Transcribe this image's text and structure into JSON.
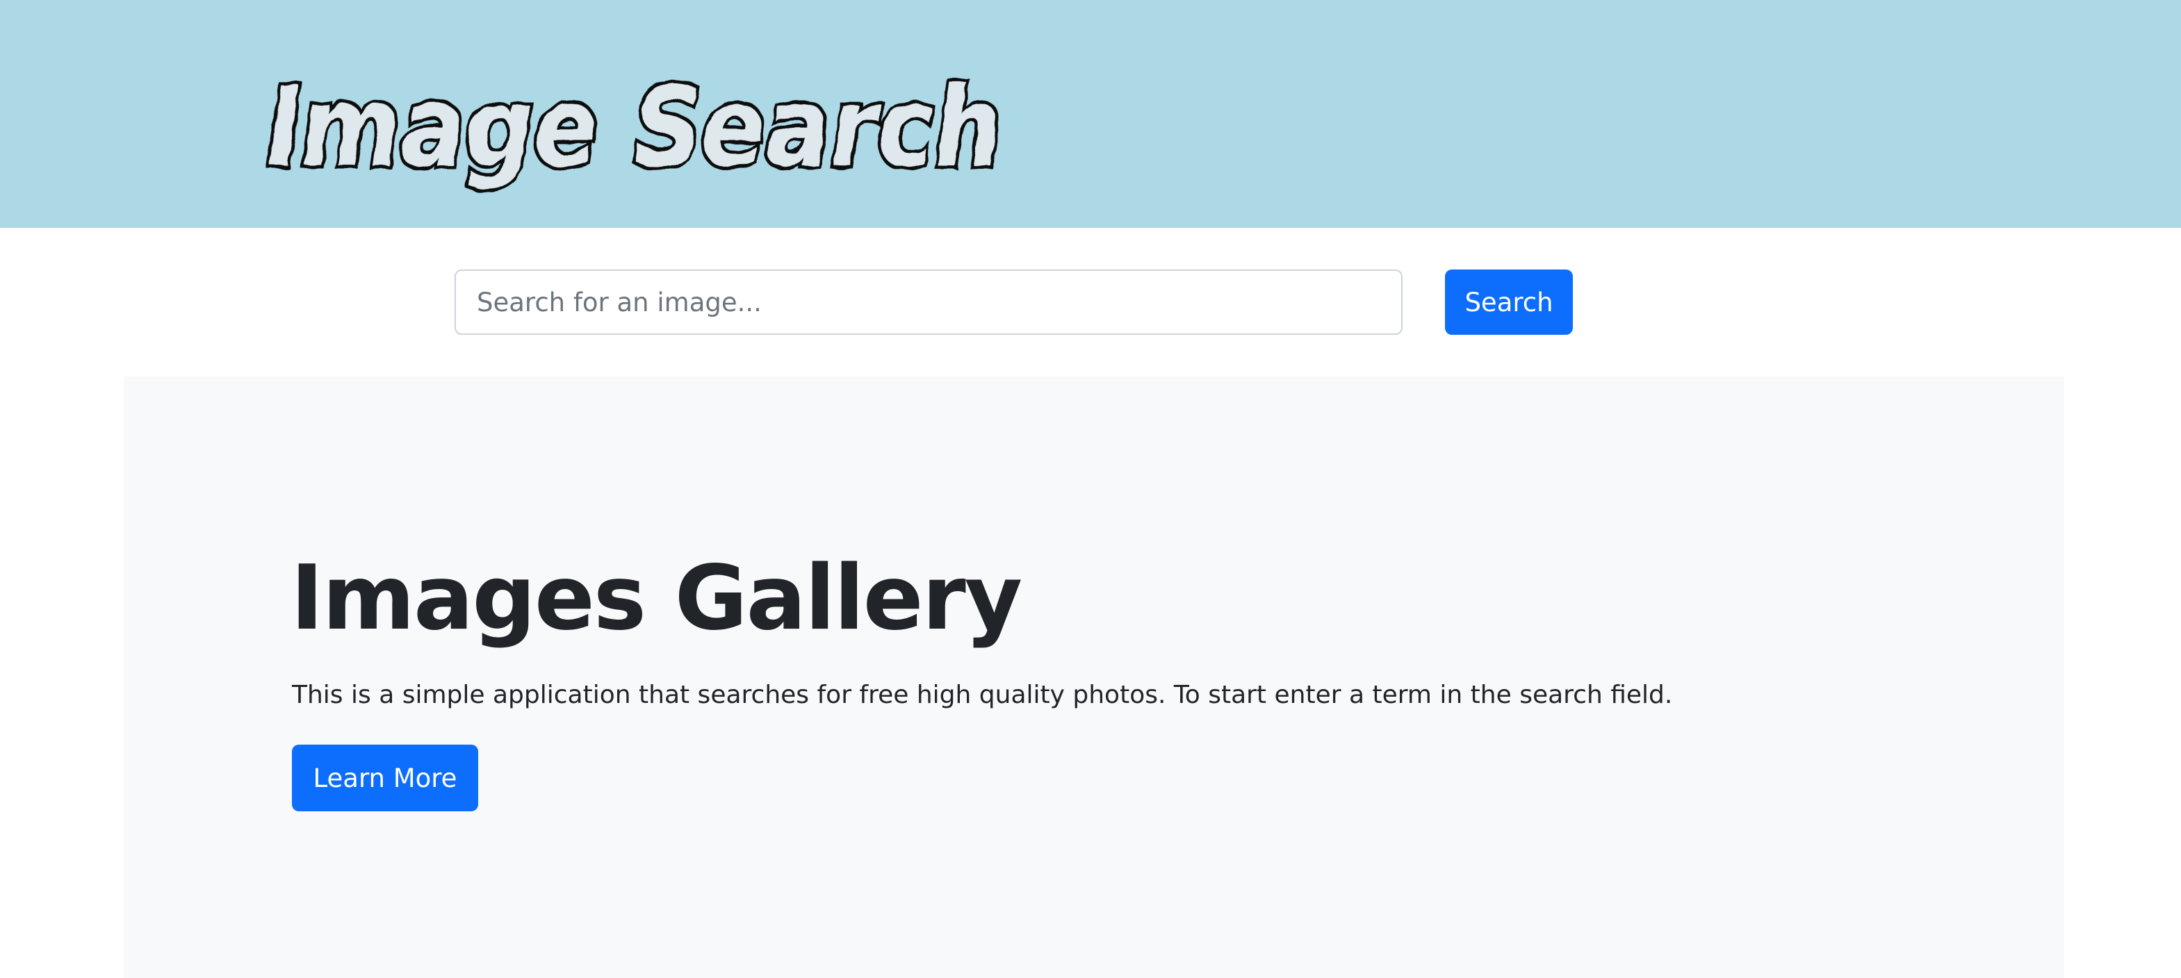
{
  "header": {
    "logo_text": "Image Search",
    "background_color": "#add8e6"
  },
  "search": {
    "placeholder": "Search for an image...",
    "value": "",
    "button_label": "Search"
  },
  "jumbotron": {
    "title": "Images Gallery",
    "description": "This is a simple application that searches for free high quality photos. To start enter a term in the search field.",
    "button_label": "Learn More"
  },
  "colors": {
    "primary": "#0d6efd",
    "text": "#212529",
    "jumbotron_bg": "#f8f9fa"
  }
}
